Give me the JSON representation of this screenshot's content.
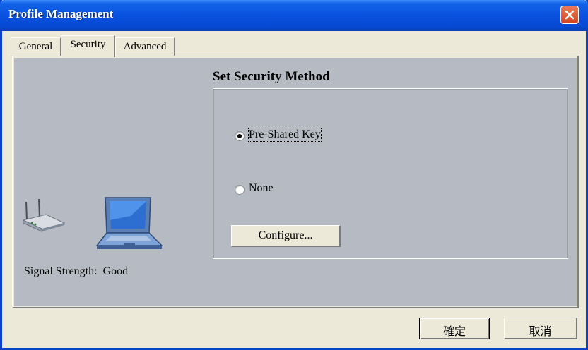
{
  "window": {
    "title": "Profile Management"
  },
  "tabs": [
    {
      "label": "General"
    },
    {
      "label": "Security",
      "active": true
    },
    {
      "label": "Advanced"
    }
  ],
  "security": {
    "section_title": "Set Security Method",
    "options": [
      {
        "label": "Pre-Shared Key",
        "selected": true
      },
      {
        "label": "None",
        "selected": false
      }
    ],
    "configure_label": "Configure..."
  },
  "status": {
    "signal_label": "Signal Strength:",
    "signal_value": "Good"
  },
  "footer": {
    "ok_label": "確定",
    "cancel_label": "取消"
  },
  "icons": {
    "close": "close-icon",
    "router": "router-icon",
    "laptop": "laptop-icon"
  },
  "colors": {
    "titlebar": "#0852df",
    "panel": "#b6bbc3",
    "window": "#ece9d8",
    "close": "#d2451d"
  }
}
